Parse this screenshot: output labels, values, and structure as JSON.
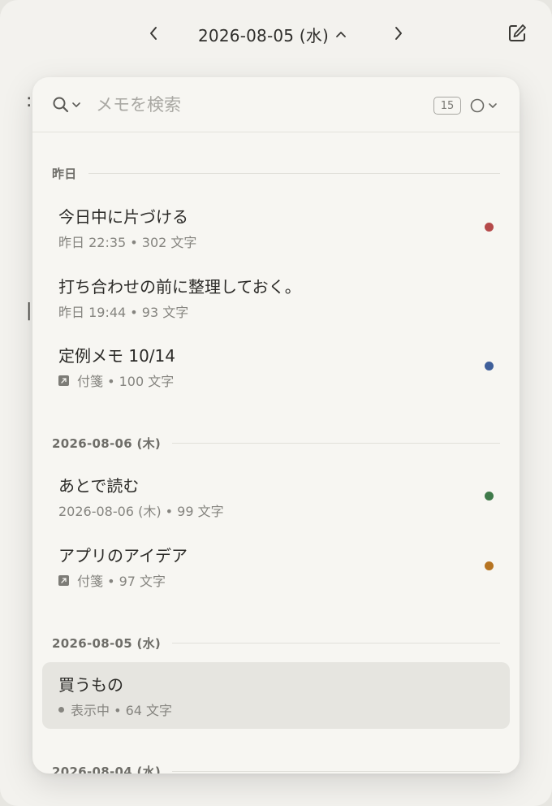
{
  "header": {
    "date_title": "2026-08-05 (水)"
  },
  "search": {
    "placeholder": "メモを検索",
    "count": "15"
  },
  "sections": [
    {
      "label": "昨日"
    },
    {
      "label": "2026-08-06 (木)"
    },
    {
      "label": "2026-08-05 (水)"
    },
    {
      "label": "2026-08-04 (水)"
    }
  ],
  "memos": [
    {
      "title": "今日中に片づける",
      "meta": "昨日 22:35 • 302 文字",
      "color": "#b54a4a"
    },
    {
      "title": "打ち合わせの前に整理しておく。",
      "meta": "昨日 19:44 • 93 文字",
      "color": ""
    },
    {
      "title": "定例メモ 10/14",
      "meta": "付箋 • 100 文字",
      "color": "#3f5f9a"
    },
    {
      "title": "あとで読む",
      "meta": "2026-08-06 (木) • 99 文字",
      "color": "#3f7a4a"
    },
    {
      "title": "アプリのアイデア",
      "meta": "付箋 • 97 文字",
      "color": "#b67422"
    },
    {
      "title": "買うもの",
      "meta": "表示中 • 64 文字",
      "color": ""
    }
  ],
  "icons": {
    "prev": "chevron-left-icon",
    "next": "chevron-right-icon",
    "title_toggle": "chevron-up-icon",
    "compose": "compose-icon",
    "search": "search-icon",
    "filter": "circle-icon",
    "sticky": "sticky-note-icon"
  },
  "colors": {
    "background": "#f3f2ee",
    "popover": "#f7f6f2",
    "selected_row": "#e6e5e0"
  }
}
